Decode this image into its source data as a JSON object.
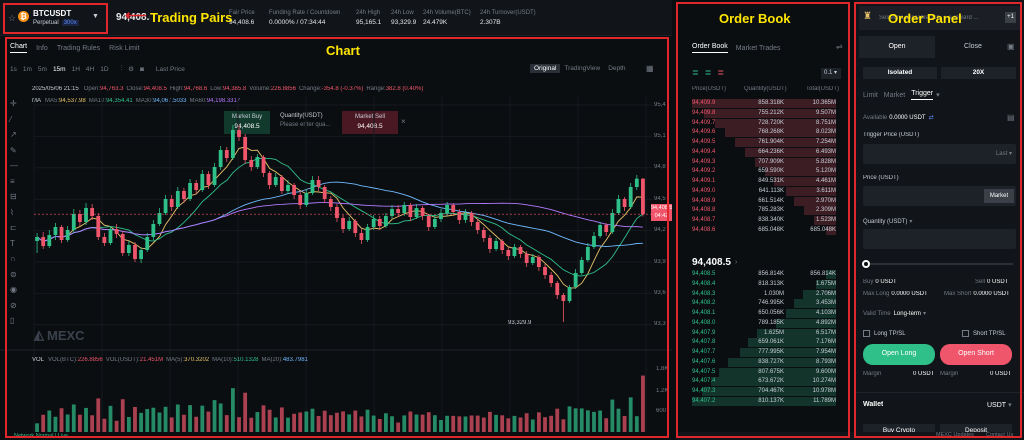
{
  "annotations": {
    "trading_pairs": "Trading Pairs",
    "chart": "Chart",
    "order_book": "Order Book",
    "order_panel": "Order Panel"
  },
  "pair": {
    "symbol": "BTCUSDT",
    "type": "Perpetual",
    "leverage": "300x",
    "last_price": "94,408.5"
  },
  "stats": [
    {
      "label": "Fair Price",
      "value": "94,408.6"
    },
    {
      "label": "Funding Rate / Countdown",
      "value": "0.0000% / 07:34:44"
    },
    {
      "label": "24h High",
      "value": "95,165.1"
    },
    {
      "label": "24h Low",
      "value": "93,329.9"
    },
    {
      "label": "24h Volume(BTC)",
      "value": "24.479K"
    },
    {
      "label": "24h Turnover(USDT)",
      "value": "2.307B"
    }
  ],
  "chart_tabs": [
    "Chart",
    "Info",
    "Trading Rules",
    "Risk Limit"
  ],
  "timeframes": [
    "1s",
    "1m",
    "5m",
    "15m",
    "1H",
    "4H",
    "1D"
  ],
  "timeframe_selected": "15m",
  "last_price_menu": "Last Price",
  "views": [
    "Original",
    "TradingView",
    "Depth"
  ],
  "ohlc": {
    "date": "2025/05/06 21:15",
    "open_l": "Open:",
    "open": "94,763.3",
    "close_l": "Close:",
    "close": "94,408.5",
    "high_l": "High:",
    "high": "94,768.6",
    "low_l": "Low:",
    "low": "94,385.8",
    "vol_l": "Volume:",
    "vol": "226.8856",
    "chg_l": "Change:",
    "chg": "-354.8 (-0.37%)",
    "range_l": "Range:",
    "range": "382.8 (0.40%)"
  },
  "ma": {
    "label": "MA",
    "ma5_l": "MA5:",
    "ma5": "94,537.98",
    "ma10_l": "MA10:",
    "ma10": "94,354.41",
    "ma30_l": "MA30:",
    "ma30": "94,067.5033",
    "ma60_l": "MA60:",
    "ma60": "94,198.3317"
  },
  "quick": {
    "buy_l": "Market Buy",
    "buy_p": "94,408.5",
    "qty_l": "Quantity(USDT)",
    "qty_ph": "Please enter qua...",
    "sell_l": "Market Sell",
    "sell_p": "94,408.5"
  },
  "price_axis": [
    "95,4",
    "95,1",
    "94,8",
    "94,5",
    "94,2",
    "93,9",
    "93,6",
    "93,3"
  ],
  "price_tag": {
    "top": "94,408.5",
    "bottom": "04:42"
  },
  "low_label": "93,329.9",
  "watermark": "MEXC",
  "vol": {
    "label": "VOL",
    "btc_l": "VOL(BTC):",
    "btc": "226.8856",
    "usdt_l": "VOL(USDT):",
    "usdt": "21.451M",
    "ma5_l": "MA(5):",
    "ma5": "370.3202",
    "ma10_l": "MA(10):",
    "ma10": "510.1328",
    "ma20_l": "MA(20):",
    "ma20": "483.7981",
    "axis": [
      "1.8K",
      "1.2K",
      "600"
    ]
  },
  "chart_data": {
    "type": "candlestick",
    "ylim": [
      93200,
      95500
    ],
    "candles": [
      [
        94140,
        94180,
        94020,
        94220
      ],
      [
        94180,
        94090,
        94060,
        94230
      ],
      [
        94090,
        94200,
        94070,
        94250
      ],
      [
        94200,
        94280,
        94150,
        94320
      ],
      [
        94280,
        94150,
        94120,
        94300
      ],
      [
        94150,
        94250,
        94130,
        94290
      ],
      [
        94250,
        94410,
        94220,
        94460
      ],
      [
        94410,
        94330,
        94290,
        94450
      ],
      [
        94330,
        94470,
        94300,
        94520
      ],
      [
        94470,
        94390,
        94350,
        94510
      ],
      [
        94390,
        94180,
        94150,
        94420
      ],
      [
        94180,
        94120,
        94090,
        94220
      ],
      [
        94120,
        94260,
        94100,
        94290
      ],
      [
        94260,
        94210,
        94170,
        94310
      ],
      [
        94210,
        94020,
        93990,
        94240
      ],
      [
        94020,
        94100,
        93990,
        94140
      ],
      [
        94100,
        93960,
        93930,
        94130
      ],
      [
        93960,
        94050,
        93920,
        94080
      ],
      [
        94050,
        94180,
        94030,
        94220
      ],
      [
        94180,
        94310,
        94150,
        94350
      ],
      [
        94310,
        94420,
        94290,
        94470
      ],
      [
        94420,
        94560,
        94400,
        94600
      ],
      [
        94560,
        94480,
        94440,
        94600
      ],
      [
        94480,
        94640,
        94460,
        94680
      ],
      [
        94640,
        94560,
        94520,
        94670
      ],
      [
        94560,
        94720,
        94540,
        94760
      ],
      [
        94720,
        94650,
        94610,
        94750
      ],
      [
        94650,
        94810,
        94630,
        94850
      ],
      [
        94810,
        94700,
        94660,
        94840
      ],
      [
        94700,
        94880,
        94680,
        94920
      ],
      [
        94880,
        95050,
        94850,
        95090
      ],
      [
        95050,
        94970,
        94930,
        95080
      ],
      [
        94970,
        95250,
        94950,
        95300
      ],
      [
        95250,
        95180,
        95140,
        95300
      ],
      [
        95180,
        94950,
        94910,
        95210
      ],
      [
        94950,
        94880,
        94840,
        94990
      ],
      [
        94880,
        94980,
        94860,
        95010
      ],
      [
        94980,
        94820,
        94780,
        95000
      ],
      [
        94820,
        94700,
        94660,
        94840
      ],
      [
        94700,
        94780,
        94680,
        94820
      ],
      [
        94780,
        94640,
        94610,
        94800
      ],
      [
        94640,
        94700,
        94610,
        94750
      ],
      [
        94700,
        94600,
        94560,
        94720
      ],
      [
        94600,
        94500,
        94460,
        94640
      ],
      [
        94500,
        94620,
        94480,
        94660
      ],
      [
        94620,
        94750,
        94600,
        94790
      ],
      [
        94750,
        94680,
        94640,
        94790
      ],
      [
        94680,
        94560,
        94520,
        94700
      ],
      [
        94560,
        94480,
        94440,
        94590
      ],
      [
        94480,
        94370,
        94330,
        94510
      ],
      [
        94370,
        94260,
        94220,
        94400
      ],
      [
        94260,
        94340,
        94240,
        94380
      ],
      [
        94340,
        94220,
        94180,
        94360
      ],
      [
        94220,
        94150,
        94110,
        94260
      ],
      [
        94150,
        94280,
        94130,
        94310
      ],
      [
        94280,
        94360,
        94250,
        94400
      ],
      [
        94360,
        94290,
        94250,
        94390
      ],
      [
        94290,
        94390,
        94270,
        94420
      ],
      [
        94390,
        94460,
        94360,
        94500
      ],
      [
        94460,
        94420,
        94380,
        94500
      ],
      [
        94420,
        94500,
        94390,
        94530
      ],
      [
        94500,
        94380,
        94340,
        94520
      ],
      [
        94380,
        94470,
        94360,
        94510
      ],
      [
        94470,
        94390,
        94350,
        94490
      ],
      [
        94390,
        94280,
        94240,
        94410
      ],
      [
        94280,
        94360,
        94260,
        94400
      ],
      [
        94360,
        94420,
        94330,
        94460
      ],
      [
        94420,
        94500,
        94390,
        94530
      ],
      [
        94500,
        94430,
        94400,
        94520
      ],
      [
        94430,
        94350,
        94310,
        94460
      ],
      [
        94350,
        94420,
        94320,
        94460
      ],
      [
        94420,
        94330,
        94290,
        94440
      ],
      [
        94330,
        94250,
        94210,
        94360
      ],
      [
        94250,
        94170,
        94130,
        94280
      ],
      [
        94170,
        94060,
        94020,
        94200
      ],
      [
        94060,
        94140,
        94040,
        94170
      ],
      [
        94140,
        94050,
        94010,
        94160
      ],
      [
        94050,
        93990,
        93950,
        94080
      ],
      [
        93990,
        94080,
        93970,
        94110
      ],
      [
        94080,
        94010,
        93970,
        94100
      ],
      [
        94010,
        93920,
        93880,
        94040
      ],
      [
        93920,
        93980,
        93900,
        94010
      ],
      [
        93980,
        93880,
        93840,
        94000
      ],
      [
        93880,
        93800,
        93760,
        93910
      ],
      [
        93800,
        93720,
        93680,
        93830
      ],
      [
        93720,
        93600,
        93560,
        93740
      ],
      [
        93600,
        93540,
        93330,
        93620
      ],
      [
        93540,
        93680,
        93520,
        93700
      ],
      [
        93680,
        93820,
        93660,
        93860
      ],
      [
        93820,
        93950,
        93800,
        93980
      ],
      [
        93950,
        94080,
        93930,
        94120
      ],
      [
        94080,
        94190,
        94060,
        94230
      ],
      [
        94190,
        94300,
        94170,
        94330
      ],
      [
        94300,
        94230,
        94190,
        94320
      ],
      [
        94230,
        94420,
        94210,
        94460
      ],
      [
        94420,
        94560,
        94400,
        94600
      ],
      [
        94560,
        94480,
        94440,
        94580
      ],
      [
        94480,
        94680,
        94460,
        94720
      ],
      [
        94680,
        94763,
        94650,
        94800
      ],
      [
        94763,
        94408,
        94385,
        94769
      ]
    ],
    "volume_max": 1800
  },
  "orderbook": {
    "tabs": [
      "Order Book",
      "Market Trades"
    ],
    "precision": "0.1",
    "headers": [
      "Price(USDT)",
      "Quantity(USDT)",
      "Total(USDT)"
    ],
    "asks": [
      [
        "94,409.9",
        "858.318K",
        "10.365M"
      ],
      [
        "94,409.8",
        "755.212K",
        "9.507M"
      ],
      [
        "94,409.7",
        "728.720K",
        "8.751M"
      ],
      [
        "94,409.6",
        "768.268K",
        "8.023M"
      ],
      [
        "94,409.5",
        "761.904K",
        "7.254M"
      ],
      [
        "94,409.4",
        "664.236K",
        "6.493M"
      ],
      [
        "94,409.3",
        "707.909K",
        "5.828M"
      ],
      [
        "94,409.2",
        "659.590K",
        "5.120M"
      ],
      [
        "94,409.1",
        "849.531K",
        "4.461M"
      ],
      [
        "94,409.0",
        "641.113K",
        "3.611M"
      ],
      [
        "94,408.9",
        "661.514K",
        "2.970M"
      ],
      [
        "94,408.8",
        "785.283K",
        "2.309M"
      ],
      [
        "94,408.7",
        "838.340K",
        "1.523M"
      ],
      [
        "94,408.6",
        "685.048K",
        "685.048K"
      ]
    ],
    "ask_fill": [
      1,
      0.92,
      0.84,
      0.77,
      0.7,
      0.63,
      0.56,
      0.49,
      0.43,
      0.35,
      0.29,
      0.22,
      0.15,
      0.07
    ],
    "mid": "94,408.5",
    "bids": [
      [
        "94,408.5",
        "856.814K",
        "856.814K"
      ],
      [
        "94,408.4",
        "818.313K",
        "1.675M"
      ],
      [
        "94,408.3",
        "1.030M",
        "2.706M"
      ],
      [
        "94,408.2",
        "746.995K",
        "3.453M"
      ],
      [
        "94,408.1",
        "650.056K",
        "4.103M"
      ],
      [
        "94,408.0",
        "789.185K",
        "4.892M"
      ],
      [
        "94,407.9",
        "1.625M",
        "6.517M"
      ],
      [
        "94,407.8",
        "659.061K",
        "7.176M"
      ],
      [
        "94,407.7",
        "777.995K",
        "7.954M"
      ],
      [
        "94,407.6",
        "838.727K",
        "8.793M"
      ],
      [
        "94,407.5",
        "807.675K",
        "9.600M"
      ],
      [
        "94,407.4",
        "673.672K",
        "10.274M"
      ],
      [
        "94,407.3",
        "704.467K",
        "10.978M"
      ],
      [
        "94,407.2",
        "810.137K",
        "11.789M"
      ]
    ],
    "bid_fill": [
      0.07,
      0.14,
      0.23,
      0.29,
      0.35,
      0.42,
      0.55,
      0.61,
      0.67,
      0.75,
      0.81,
      0.87,
      0.93,
      1
    ]
  },
  "order": {
    "promo": "Sessions available 11h, + a reward ...",
    "tabs": [
      "Open",
      "Close"
    ],
    "margin_mode": "Isolated",
    "leverage": "20X",
    "types": [
      "Limit",
      "Market",
      "Trigger"
    ],
    "available_l": "Available",
    "available": "0.0000 USDT",
    "trigger_l": "Trigger Price (USDT)",
    "trigger_sel": "Last",
    "price_l": "Price (USDT)",
    "price_btn": "Market",
    "qty_l": "Quantity (USDT)",
    "buy_l": "Buy",
    "buy": "0 USDT",
    "sell_l": "Sell",
    "sell": "0 USDT",
    "maxlong_l": "Max Long",
    "maxlong": "0.0000 USDT",
    "maxshort_l": "Max Short",
    "maxshort": "0.0000 USDT",
    "valid_l": "Valid Time",
    "valid": "Long-term",
    "long_tpsl": "Long TP/SL",
    "short_tpsl": "Short TP/SL",
    "open_long": "Open Long",
    "open_short": "Open Short",
    "margin_l": "Margin",
    "margin_long": "0 USDT",
    "margin_short": "0 USDT",
    "wallet_l": "Wallet",
    "wallet_cur": "USDT",
    "buy_crypto": "Buy Crypto",
    "deposit": "Deposit"
  },
  "footer": {
    "left": "Network Normal | Live",
    "updates": "MEXC Updates",
    "contact": "Contact Us"
  },
  "colors": {
    "up": "#2fc08a",
    "down": "#f0566b",
    "accent": "#e0272b",
    "annotation": "#ffe600"
  }
}
